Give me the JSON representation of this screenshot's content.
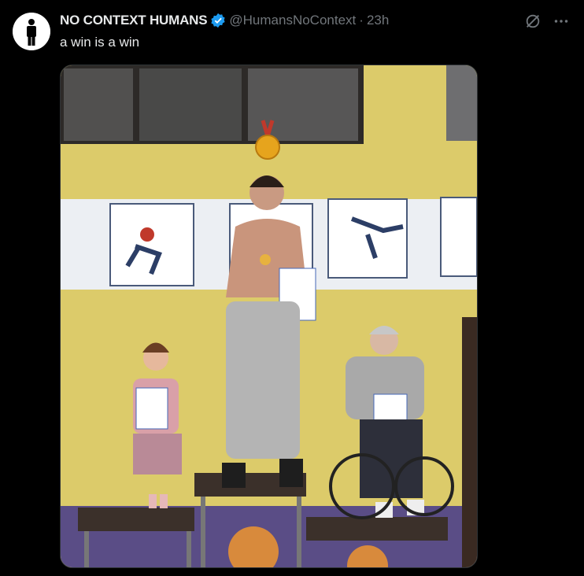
{
  "tweet": {
    "author_name": "NO CONTEXT HUMANS",
    "handle": "@HumansNoContext",
    "separator": "·",
    "time": "23h",
    "text": "a win is a win",
    "verified": true,
    "avatar_icon": "standing-person-icon",
    "media_description_icon": "photo"
  },
  "colors": {
    "background": "#000000",
    "text": "#e7e9ea",
    "muted": "#71767b",
    "verified": "#1d9bf0"
  }
}
